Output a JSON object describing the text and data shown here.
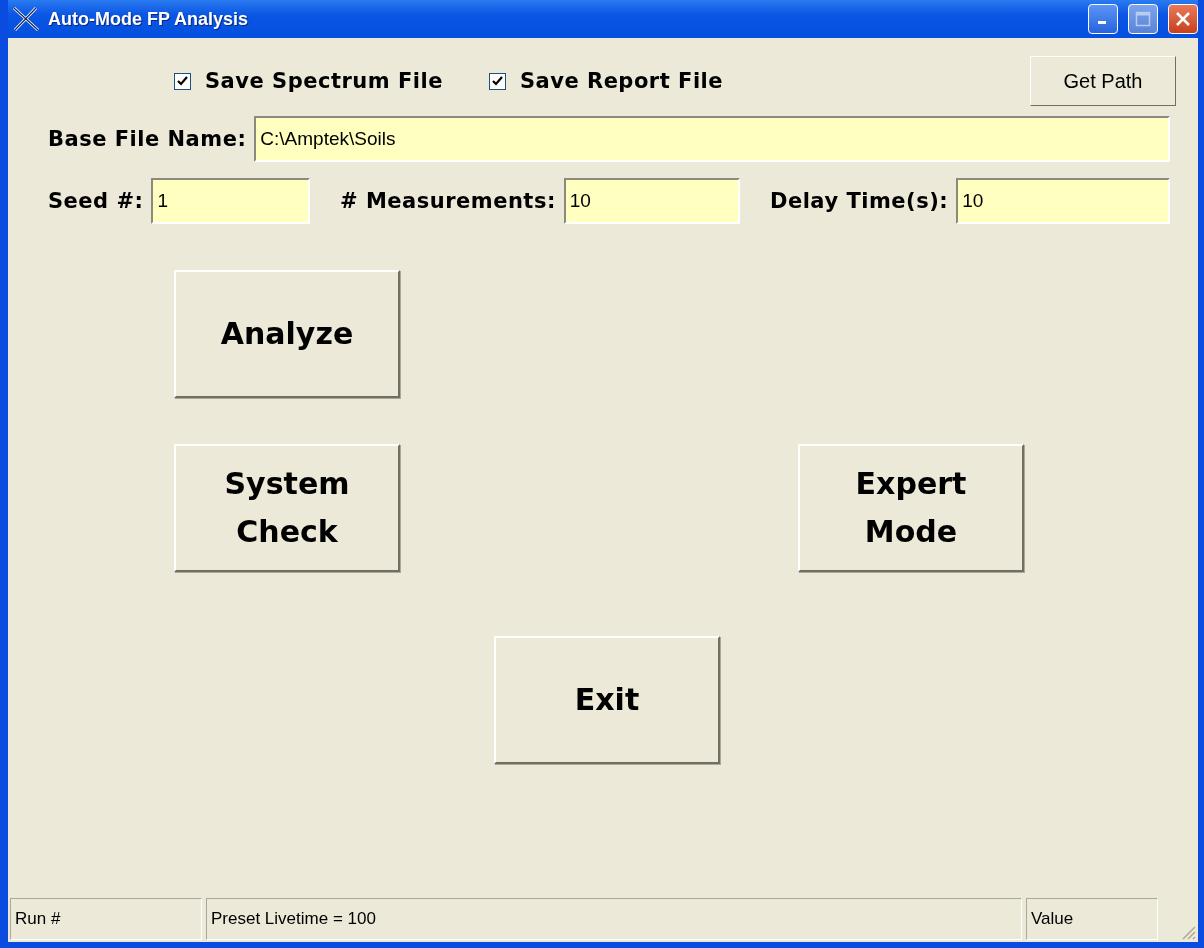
{
  "window": {
    "title": "Auto-Mode FP Analysis"
  },
  "options": [
    {
      "label": "Save Spectrum File",
      "checked": true
    },
    {
      "label": "Save Report File",
      "checked": true
    }
  ],
  "get_path_button": "Get Path",
  "base_file_name": {
    "label": "Base File Name:",
    "value": "C:\\Amptek\\Soils"
  },
  "fields": [
    {
      "label": "Seed #:",
      "value": "1"
    },
    {
      "label": "# Measurements:",
      "value": "10"
    },
    {
      "label": "Delay Time(s):",
      "value": "10"
    }
  ],
  "buttons": [
    {
      "label": "Analyze"
    },
    {
      "label": "System Check"
    },
    {
      "label": "Expert Mode"
    },
    {
      "label": "Exit"
    }
  ],
  "status_bar": [
    "Run #",
    "Preset Livetime = 100",
    "Value"
  ]
}
